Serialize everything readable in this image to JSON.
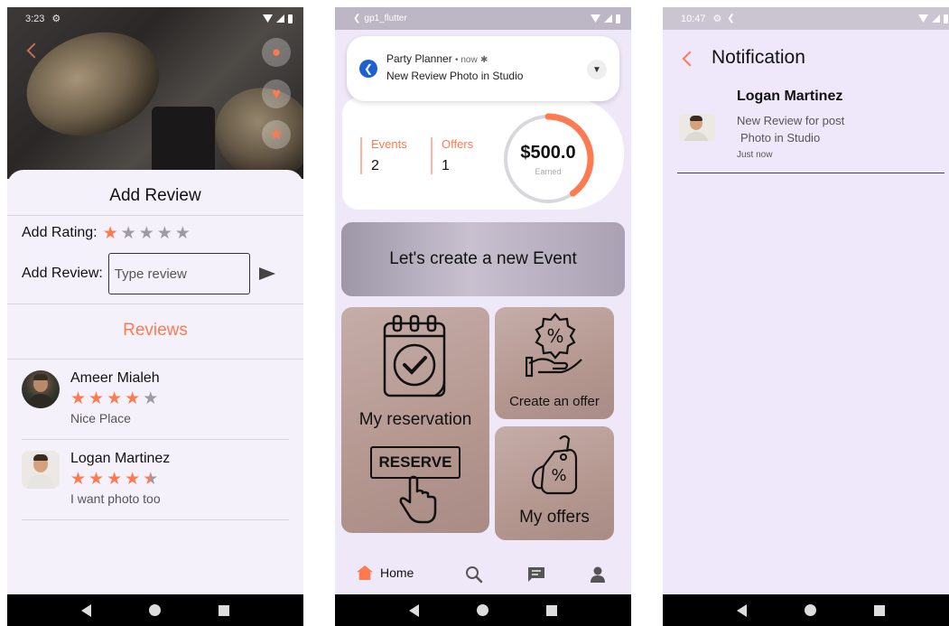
{
  "screen1": {
    "status": {
      "time": "3:23"
    },
    "sheet_title": "Add Review",
    "rating_label": "Add Rating:",
    "rating_value": 1,
    "rating_max": 5,
    "review_label": "Add Review:",
    "review_placeholder": "Type review",
    "reviews_title": "Reviews",
    "reviews": [
      {
        "name": "Ameer Mialeh",
        "rating": 4,
        "text": "Nice Place"
      },
      {
        "name": "Logan Martinez",
        "rating": 4.5,
        "text": "I want photo too"
      }
    ]
  },
  "screen2": {
    "status": {
      "app": "gp1_flutter"
    },
    "notification": {
      "app_name": "Party Planner",
      "time": "now",
      "text": "New Review Photo in Studio"
    },
    "stats": [
      {
        "label": "Events",
        "value": "2"
      },
      {
        "label": "Offers",
        "value": "1"
      }
    ],
    "earned": {
      "amount": "$500.0",
      "label": "Earned",
      "progress": 0.4
    },
    "create_event": "Let's create a new Event",
    "tiles": {
      "reservation": "My reservation",
      "reserve_sign": "RESERVE",
      "create_offer": "Create an offer",
      "my_offers": "My offers"
    },
    "bottom_nav": {
      "home": "Home"
    }
  },
  "screen3": {
    "status": {
      "time": "10:47"
    },
    "title": "Notification",
    "notification": {
      "name": "Logan Martinez",
      "line1": "New Review for post",
      "line2": "Photo in Studio",
      "time": "Just now"
    }
  },
  "colors": {
    "accent": "#ff7a50",
    "background": "#efe8fb"
  }
}
